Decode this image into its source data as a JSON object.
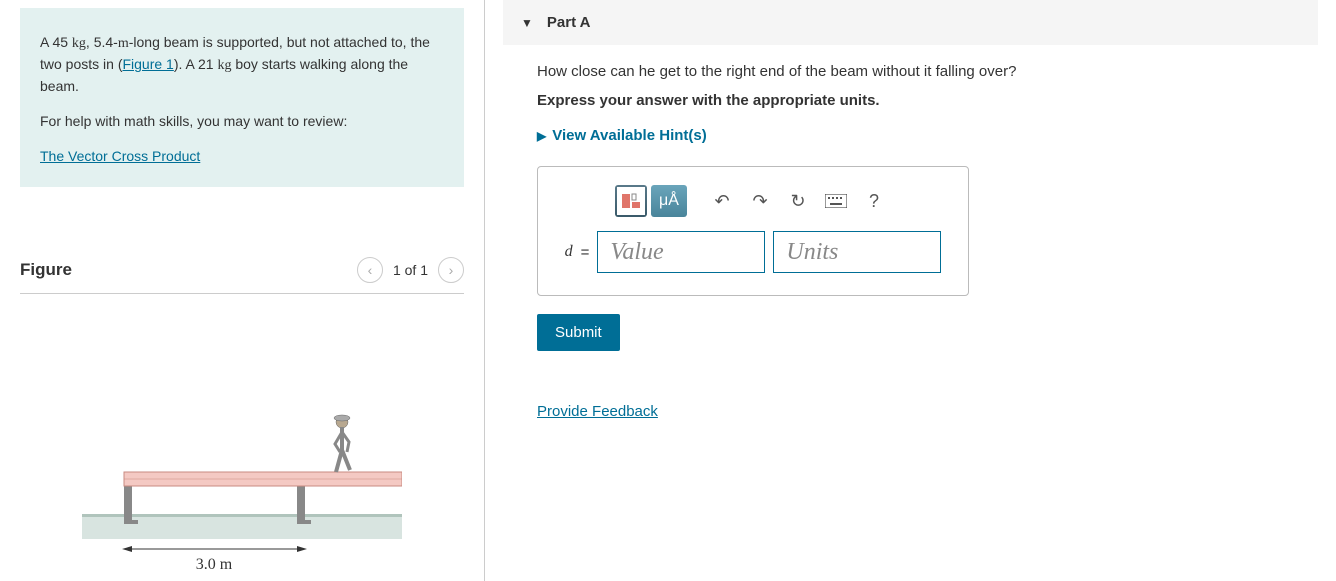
{
  "problem": {
    "text_prefix": "A 45 ",
    "unit1": "kg",
    "text_mid1": ", 5.4-",
    "unit_m": "m",
    "text_mid2": "-long beam is supported, but not attached to, the two posts in (",
    "figure_link": "Figure 1",
    "text_mid3": "). A 21 ",
    "unit2": "kg",
    "text_suffix": " boy starts walking along the beam.",
    "help_text": "For help with math skills, you may want to review:",
    "help_link": "The Vector Cross Product"
  },
  "figure": {
    "title": "Figure",
    "count": "1 of 1",
    "dimension_label": "3.0 m"
  },
  "part": {
    "label": "Part A",
    "question": "How close can he get to the right end of the beam without it falling over?",
    "instruction": "Express your answer with the appropriate units.",
    "hints_label": "View Available Hint(s)",
    "toolbar": {
      "mu_label": "μÅ"
    },
    "variable": "d",
    "equals": "=",
    "value_placeholder": "Value",
    "units_placeholder": "Units",
    "submit": "Submit"
  },
  "feedback": "Provide Feedback"
}
